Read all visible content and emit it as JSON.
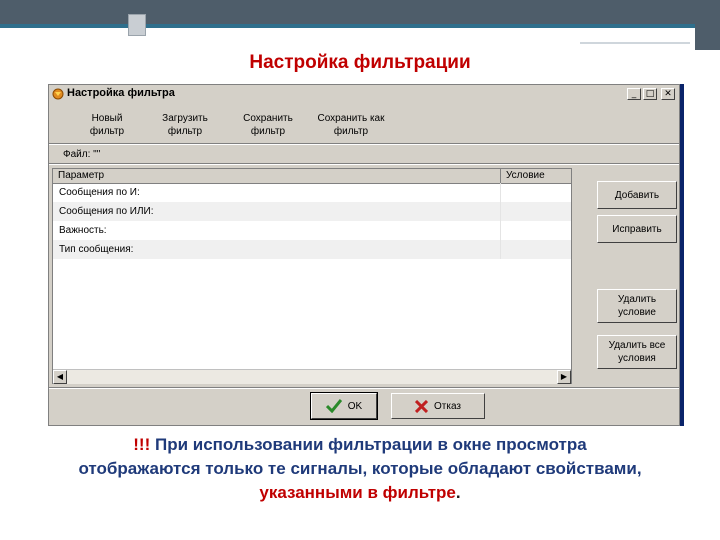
{
  "slide": {
    "title": "Настройка фильтрации",
    "caption_mark": "!!!",
    "caption_line1": "При использовании фильтрации в окне просмотра",
    "caption_line2": "отображаются только те сигналы, которые обладают свойствами,",
    "caption_line3_red": "указанными в фильтре",
    "caption_line3_end": "."
  },
  "window": {
    "title": "Настройка фильтра",
    "controls": {
      "minimize": "_",
      "maximize": "□",
      "close": "✕"
    }
  },
  "toolbar": {
    "new": [
      "Новый",
      "фильтр"
    ],
    "load": [
      "Загрузить",
      "фильтр"
    ],
    "save": [
      "Сохранить",
      "фильтр"
    ],
    "save_as": [
      "Сохранить как",
      "фильтр"
    ]
  },
  "file_label": "Файл: \"\"",
  "grid": {
    "columns": [
      "Параметр",
      "Условие"
    ],
    "rows": [
      {
        "param": "Сообщения по И:",
        "cond": ""
      },
      {
        "param": "Сообщения по ИЛИ:",
        "cond": ""
      },
      {
        "param": "Важность:",
        "cond": ""
      },
      {
        "param": "Тип сообщения:",
        "cond": ""
      }
    ]
  },
  "buttons": {
    "add": "Добавить",
    "edit": "Исправить",
    "delete_cond": [
      "Удалить",
      "условие"
    ],
    "delete_all": [
      "Удалить все",
      "условия"
    ],
    "ok": "OK",
    "cancel": "Отказ"
  },
  "colors": {
    "accent_red": "#c00000",
    "caption_blue": "#1f3a7a",
    "ok_green": "#2a8a2a",
    "cancel_red": "#c02020"
  },
  "icons": {
    "ok": "check-icon",
    "cancel": "x-mark-icon",
    "app": "filter-app-icon"
  }
}
